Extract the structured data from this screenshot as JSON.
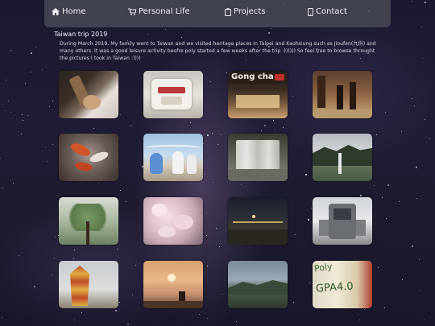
{
  "nav": {
    "items": [
      {
        "label": "Home",
        "icon": "home-icon"
      },
      {
        "label": "Personal Life",
        "icon": "cart-icon"
      },
      {
        "label": "Projects",
        "icon": "clipboard-icon"
      },
      {
        "label": "Contact",
        "icon": "mobile-icon"
      }
    ]
  },
  "section": {
    "title": "Taiwan trip 2019",
    "description": "During March 2019, My family went to Taiwan and we visited heritage places in Taipei and Kaohsiung such as Jioufen(九份) and many others. It was a good leisure activity beofre poly started a few weeks after the trip :)))))) So feel free to browse throught the pictures I took in Taiwan :))))"
  },
  "photos": {
    "sign_text": "Gong cha",
    "note_text_1": "Poly",
    "note_text_2": "GPA4.0"
  },
  "colors": {
    "navbar": "#46485499",
    "text": "#e6e6ee"
  }
}
